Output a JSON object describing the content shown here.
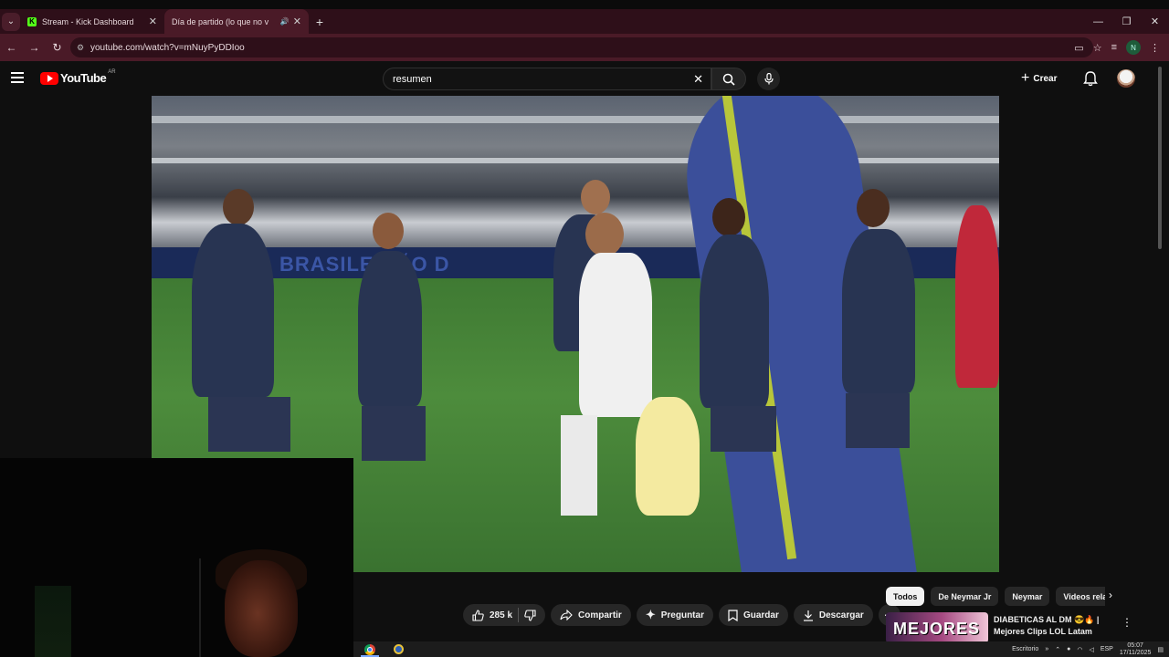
{
  "browser": {
    "tabs": [
      {
        "label": "Stream - Kick Dashboard",
        "icon": "kick-icon"
      },
      {
        "label": "Día de partido (lo que no v",
        "icon": "youtube-icon",
        "active": true
      }
    ],
    "url": "youtube.com/watch?v=mNuyPyDDIoo",
    "profile_initial": "N"
  },
  "youtube": {
    "logo_text": "YouTube",
    "country_code": "AR",
    "search_value": "resumen",
    "create_label": "Crear",
    "actions": {
      "likes": "285 k",
      "share": "Compartir",
      "ask": "Preguntar",
      "save": "Guardar",
      "download": "Descargar"
    },
    "chips": [
      "Todos",
      "De Neymar Jr",
      "Neymar",
      "Videos rela"
    ],
    "recommendation": {
      "title": "DIABETICAS AL DM 😎🔥 | Mejores Clips LOL Latam",
      "thumb_text": "MEJORES"
    }
  },
  "video": {
    "board_text": "BRASILEIRÃO D"
  },
  "taskbar": {
    "desktop_label": "Escritorio",
    "language": "ESP",
    "time": "05:07",
    "date": "17/11/2025"
  },
  "colors": {
    "tab_bar": "#2e0f19",
    "address_bar": "#4a1a27",
    "youtube_bg": "#0f0f0f",
    "youtube_red": "#ff0000",
    "kick_green": "#53fc18"
  }
}
